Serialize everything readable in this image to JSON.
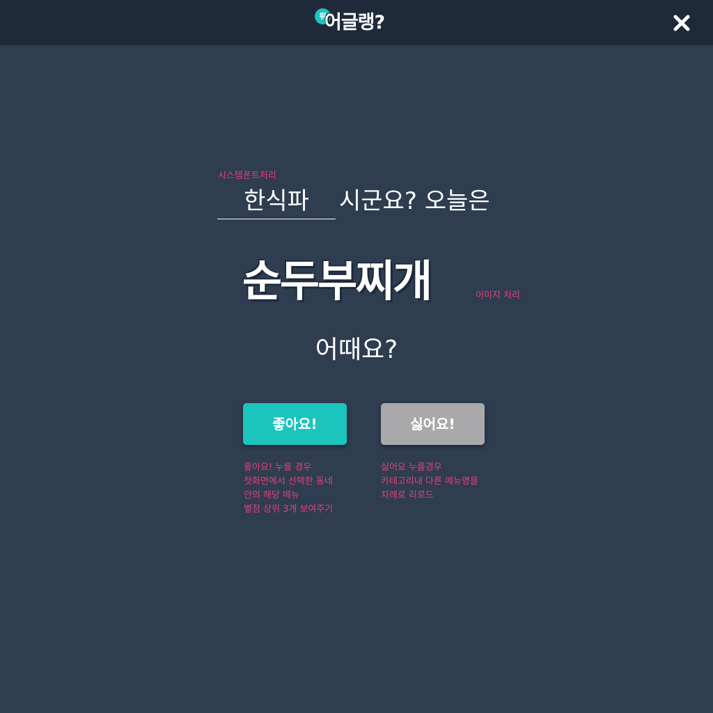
{
  "header": {
    "logo_badge": "뭐",
    "logo_text": "어글랭?",
    "close_icon": "close-icon"
  },
  "notes": {
    "system_font": "시스템폰트처리",
    "image_processing": "이미지 처리",
    "like_lines": [
      "좋아요! 누를 경우",
      "첫화면에서 선택한 동네",
      "안의 해당 메뉴",
      "별점 상위 3개 보여주기"
    ],
    "dislike_lines": [
      "싫어요 누를경우",
      "카테고리내 다른 메뉴명을",
      "차례로 리로드"
    ]
  },
  "main": {
    "category": "한식파",
    "question": "시군요? 오늘은",
    "menu_name": "순두부찌개",
    "how_about": "어때요?"
  },
  "buttons": {
    "like_label": "좋아요!",
    "dislike_label": "싫어요!"
  },
  "colors": {
    "background": "#2e3d50",
    "topbar": "#1e2a3a",
    "accent": "#1bc4bd",
    "dislike": "#a9a9ab",
    "note": "#e0407a"
  }
}
